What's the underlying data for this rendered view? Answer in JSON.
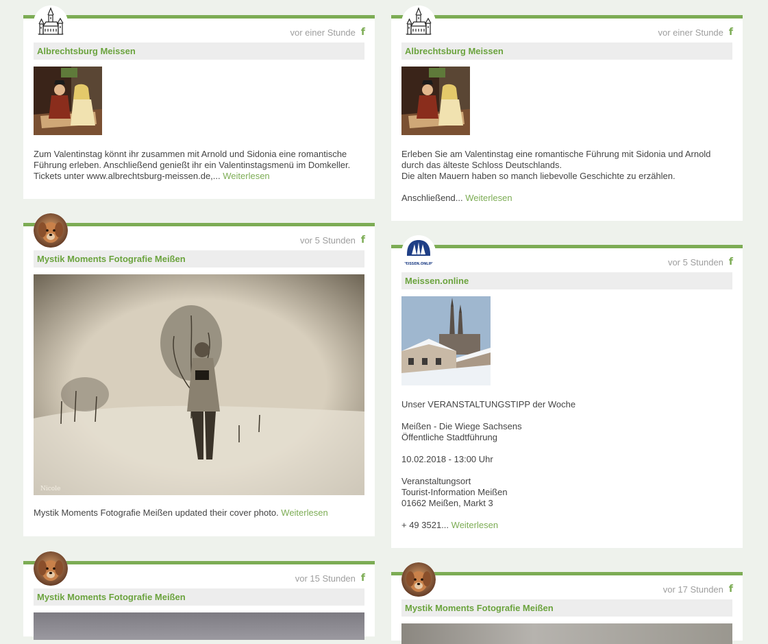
{
  "colors": {
    "accent": "#7cac54",
    "author_bg": "#ededed",
    "page_bg": "#eef2ec"
  },
  "read_more_label": "Weiterlesen",
  "posts": [
    {
      "author": "Albrechtsburg Meissen",
      "avatar_icon": "castle-logo-icon",
      "time": "vor einer Stunde",
      "source_icon": "facebook-icon",
      "text": "Zum Valentinstag könnt ihr zusammen mit Arnold und Sidonia eine romantische Führung erleben. Anschließend genießt ihr ein Valentinstagsmenü im Domkeller. Tickets unter www.albrechtsburg-meissen.de,... "
    },
    {
      "author": "Mystik Moments Fotografie Meißen",
      "avatar_icon": "dog-portrait-avatar",
      "time": "vor 5 Stunden",
      "source_icon": "facebook-icon",
      "image_signature": "Nicole",
      "text": "Mystik Moments Fotografie Meißen updated their cover photo. "
    },
    {
      "author": "Mystik Moments Fotografie Meißen",
      "avatar_icon": "dog-portrait-avatar",
      "time": "vor 15 Stunden",
      "source_icon": "facebook-icon",
      "text": ""
    },
    {
      "author": "Albrechtsburg Meissen",
      "avatar_icon": "castle-logo-icon",
      "time": "vor einer Stunde",
      "source_icon": "facebook-icon",
      "text": "Erleben Sie am Valentinstag eine romantische Führung mit Sidonia und Arnold durch das älteste Schloss Deutschlands.\nDie alten Mauern haben so manch liebevolle Geschichte zu erzählen.\n\nAnschließend... "
    },
    {
      "author": "Meissen.online",
      "avatar_icon": "meissen-online-logo-icon",
      "avatar_logo_text": "MEISSEN.ONLINE",
      "time": "vor 5 Stunden",
      "source_icon": "facebook-icon",
      "text": "Unser VERANSTALTUNGSTIPP der Woche\n\nMeißen - Die Wiege Sachsens\nÖffentliche Stadtführung\n\n10.02.2018 - 13:00 Uhr\n\nVeranstaltungsort\nTourist-Information Meißen\n01662 Meißen, Markt 3\n\n+ 49 3521... "
    },
    {
      "author": "Mystik Moments Fotografie Meißen",
      "avatar_icon": "dog-portrait-avatar",
      "time": "vor 17 Stunden",
      "source_icon": "facebook-icon",
      "text": ""
    }
  ]
}
